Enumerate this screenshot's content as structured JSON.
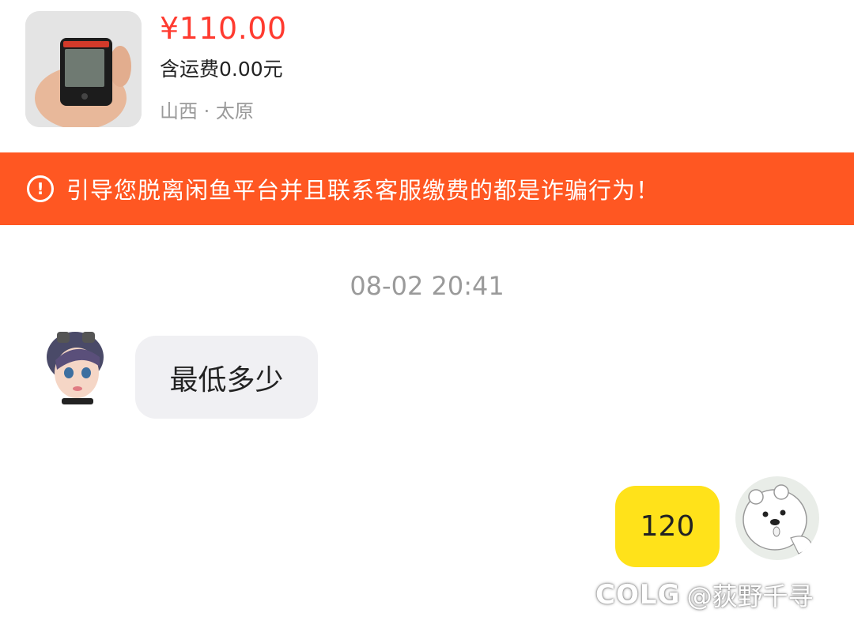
{
  "product": {
    "price": "¥110.00",
    "shipping": "含运费0.00元",
    "location": "山西 · 太原",
    "image_icon": "handheld-device-image"
  },
  "warning": {
    "icon": "!",
    "text": "引导您脱离闲鱼平台并且联系客服缴费的都是诈骗行为！"
  },
  "chat": {
    "timestamp": "08-02 20:41",
    "messages": [
      {
        "side": "left",
        "text": "最低多少"
      },
      {
        "side": "right",
        "text": "120"
      }
    ]
  },
  "watermark": {
    "logo": "COLG",
    "handle": "@荻野千寻"
  },
  "colors": {
    "price": "#ff3b30",
    "warning_bg": "#ff5722",
    "bubble_mine": "#ffe21a",
    "bubble_other": "#f0f0f3"
  }
}
